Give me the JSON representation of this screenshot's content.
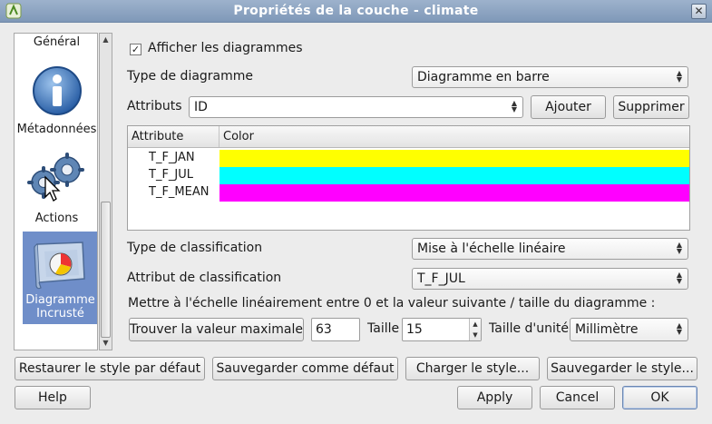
{
  "window": {
    "title": "Propriétés de la couche - climate",
    "close_glyph": "✕"
  },
  "sidebar": {
    "items": [
      {
        "label": "Général",
        "icon": "general"
      },
      {
        "label": "Métadonnées",
        "icon": "info-icon"
      },
      {
        "label": "Actions",
        "icon": "gears-icon"
      },
      {
        "label_line1": "Diagramme",
        "label_line2": "Incrusté",
        "icon": "diagram-icon",
        "selected": true
      }
    ]
  },
  "diagram": {
    "show_label": "Afficher les diagrammes",
    "show_checked": true,
    "type_label": "Type de diagramme",
    "type_value": "Diagramme en barre",
    "attributes_label": "Attributs",
    "attributes_value": "ID",
    "add_button": "Ajouter",
    "remove_button": "Supprimer",
    "table": {
      "col_attribute": "Attribute",
      "col_color": "Color",
      "rows": [
        {
          "name": "T_F_JAN",
          "color": "#ffff00"
        },
        {
          "name": "T_F_JUL",
          "color": "#00ffff"
        },
        {
          "name": "T_F_MEAN",
          "color": "#ff00ff"
        }
      ]
    },
    "classification_type_label": "Type de classification",
    "classification_type_value": "Mise à l'échelle linéaire",
    "classification_attr_label": "Attribut de classification",
    "classification_attr_value": "T_F_JUL",
    "scale_text": "Mettre à l'échelle linéairement entre 0 et la valeur suivante / taille du diagramme :",
    "find_max_button": "Trouver la valeur maximale",
    "max_value": "63",
    "size_label": "Taille",
    "size_value": "15",
    "unit_label": "Taille d'unité",
    "unit_value": "Millimètre"
  },
  "style_buttons": {
    "restore": "Restaurer le style par défaut",
    "save_default": "Sauvegarder comme défaut",
    "load": "Charger le style...",
    "save": "Sauvegarder le style..."
  },
  "dialog_buttons": {
    "help": "Help",
    "apply": "Apply",
    "cancel": "Cancel",
    "ok": "OK"
  }
}
